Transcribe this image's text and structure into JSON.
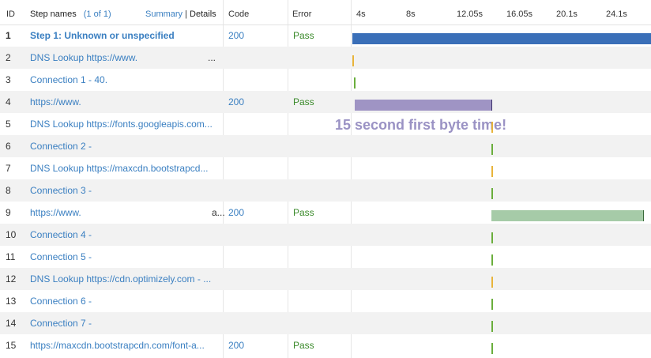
{
  "header": {
    "id": "ID",
    "step_names": "Step names",
    "step_count": "(1 of 1)",
    "summary": "Summary",
    "separator": "|",
    "details": "Details",
    "code": "Code",
    "error": "Error",
    "ticks": [
      "4s",
      "8s",
      "12.05s",
      "16.05s",
      "20.1s",
      "24.1s"
    ]
  },
  "rows": [
    {
      "id": "1",
      "name": "Step 1: Unknown or unspecified",
      "code": "200",
      "error": "Pass"
    },
    {
      "id": "2",
      "name": "DNS Lookup https://www.",
      "suffix": "...",
      "code": "",
      "error": ""
    },
    {
      "id": "3",
      "name": "Connection 1 - 40.",
      "code": "",
      "error": ""
    },
    {
      "id": "4",
      "name": "https://www.",
      "code": "200",
      "error": "Pass"
    },
    {
      "id": "5",
      "name": "DNS Lookup https://fonts.googleapis.com...",
      "code": "",
      "error": ""
    },
    {
      "id": "6",
      "name": "Connection 2 -",
      "code": "",
      "error": ""
    },
    {
      "id": "7",
      "name": "DNS Lookup https://maxcdn.bootstrapcd...",
      "code": "",
      "error": ""
    },
    {
      "id": "8",
      "name": "Connection 3 -",
      "code": "",
      "error": ""
    },
    {
      "id": "9",
      "name": "https://www.",
      "suffix": "a...",
      "code": "200",
      "error": "Pass"
    },
    {
      "id": "10",
      "name": "Connection 4 -",
      "code": "",
      "error": ""
    },
    {
      "id": "11",
      "name": "Connection 5 -",
      "code": "",
      "error": ""
    },
    {
      "id": "12",
      "name": "DNS Lookup https://cdn.optimizely.com - ...",
      "code": "",
      "error": ""
    },
    {
      "id": "13",
      "name": "Connection 6 -",
      "code": "",
      "error": ""
    },
    {
      "id": "14",
      "name": "Connection 7 -",
      "code": "",
      "error": ""
    },
    {
      "id": "15",
      "name": "https://maxcdn.bootstrapcdn.com/font-a...",
      "code": "200",
      "error": "Pass"
    }
  ],
  "annotation": "15 second first byte time!",
  "colors": {
    "step": "#3a6fb8",
    "request_wait": "#9f94c4",
    "request_receive": "#a6cba8",
    "dns": "#e8b43a",
    "connect": "#6aae3c",
    "link": "#3a7fc1",
    "pass": "#3a8a2a"
  },
  "timeline": [
    {
      "row": 0,
      "type": "step",
      "start_s": 0.0,
      "end_s": 28.5
    },
    {
      "row": 1,
      "type": "dns",
      "start_s": 0.0,
      "end_s": 0.1
    },
    {
      "row": 2,
      "type": "connect",
      "start_s": 0.1,
      "end_s": 0.2
    },
    {
      "row": 3,
      "type": "request_wait",
      "start_s": 0.2,
      "end_s": 11.7
    },
    {
      "row": 4,
      "type": "dns",
      "start_s": 11.7,
      "end_s": 11.8
    },
    {
      "row": 5,
      "type": "connect",
      "start_s": 11.7,
      "end_s": 11.8
    },
    {
      "row": 6,
      "type": "dns",
      "start_s": 11.7,
      "end_s": 11.8
    },
    {
      "row": 7,
      "type": "connect",
      "start_s": 11.7,
      "end_s": 11.8
    },
    {
      "row": 8,
      "type": "request_receive",
      "start_s": 11.7,
      "end_s": 24.5
    },
    {
      "row": 9,
      "type": "connect",
      "start_s": 11.7,
      "end_s": 11.8
    },
    {
      "row": 10,
      "type": "connect",
      "start_s": 11.7,
      "end_s": 11.8
    },
    {
      "row": 11,
      "type": "dns",
      "start_s": 11.7,
      "end_s": 11.8
    },
    {
      "row": 12,
      "type": "connect",
      "start_s": 11.7,
      "end_s": 11.8
    },
    {
      "row": 13,
      "type": "connect",
      "start_s": 11.7,
      "end_s": 11.8
    },
    {
      "row": 14,
      "type": "connect",
      "start_s": 11.7,
      "end_s": 11.8
    }
  ]
}
